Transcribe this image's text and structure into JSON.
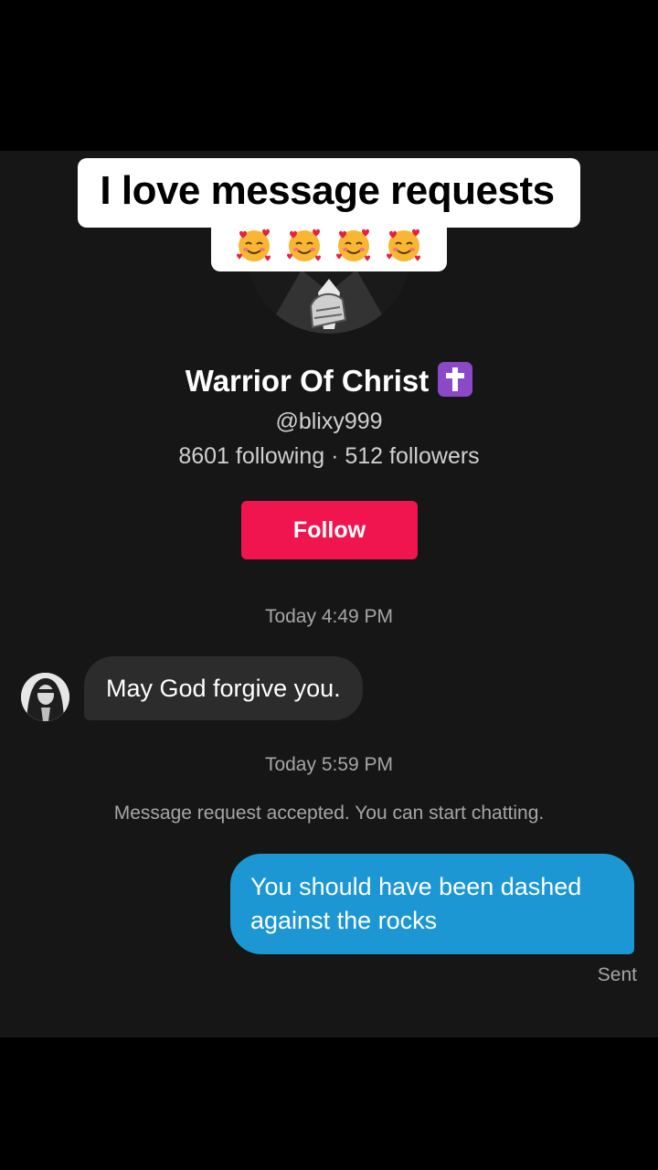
{
  "caption": {
    "line1": "I love message requests",
    "emoji_count": 4,
    "emoji_name": "smiling-face-with-hearts"
  },
  "profile": {
    "display_name": "Warrior Of Christ",
    "badge_icon": "latin-cross",
    "handle": "@blixy999",
    "stats": "8601 following · 512 followers",
    "follow_label": "Follow"
  },
  "conversation": {
    "timestamp_1": "Today 4:49 PM",
    "incoming_message": "May God forgive you.",
    "timestamp_2": "Today 5:59 PM",
    "system_message": "Message request accepted. You can start chatting.",
    "outgoing_message_line1": "You should have been dashed",
    "outgoing_message_line2": "against the rocks",
    "status": "Sent"
  },
  "colors": {
    "background": "#161616",
    "follow_button": "#f0154f",
    "outgoing_bubble": "#1d97d3",
    "incoming_bubble": "#2c2c2c",
    "badge": "#8b48c9"
  }
}
